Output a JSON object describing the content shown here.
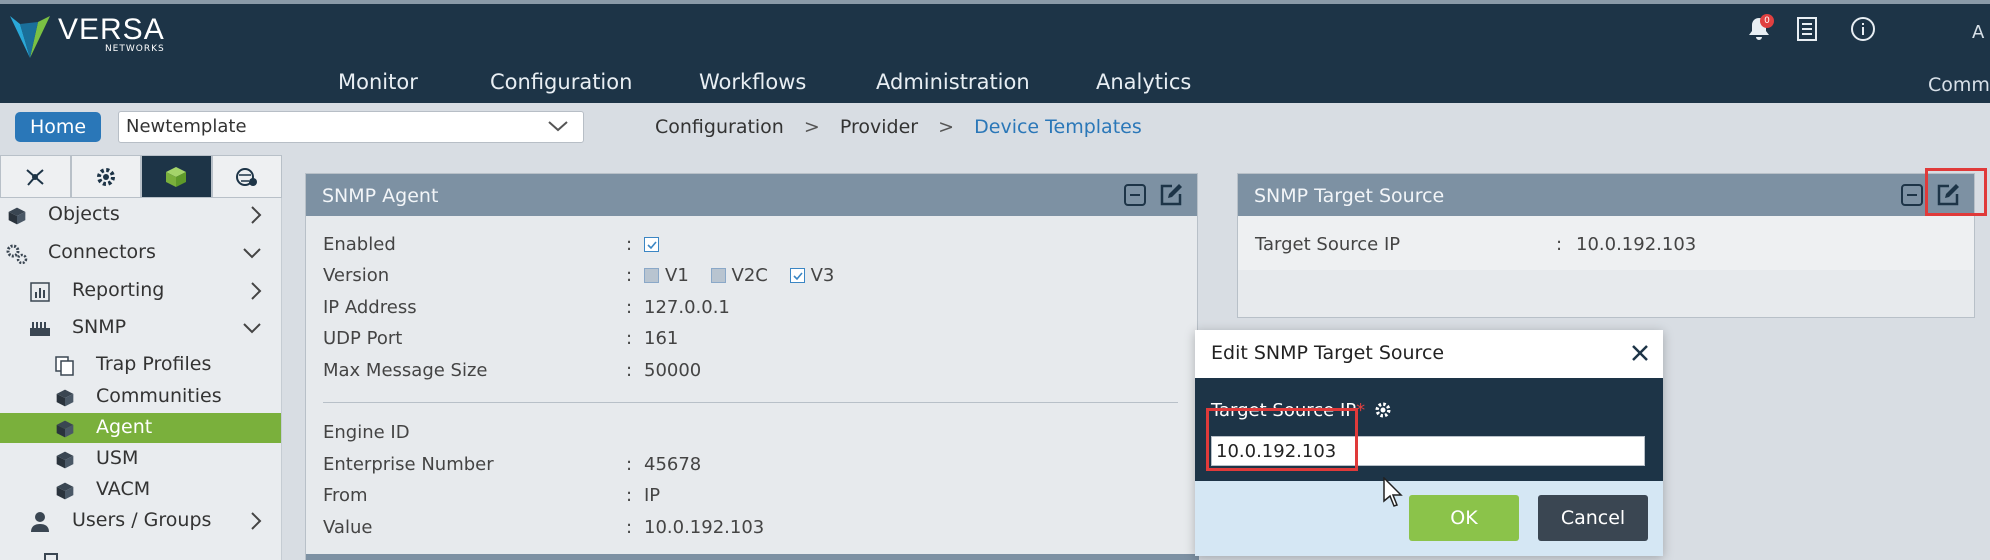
{
  "brand": {
    "name": "VERSA",
    "sub": "NETWORKS"
  },
  "header": {
    "menu": [
      "Monitor",
      "Configuration",
      "Workflows",
      "Administration",
      "Analytics"
    ],
    "notification_count": "0",
    "account_initial": "A",
    "right_menu": "Comm"
  },
  "subbar": {
    "home_label": "Home",
    "template": "Newtemplate",
    "breadcrumb": {
      "item1": "Configuration",
      "sep": ">",
      "item2": "Provider",
      "item3": "Device Templates"
    }
  },
  "sidebar": {
    "tabs": [
      "network-icon",
      "gear-icon",
      "cube-icon",
      "globe-gear-icon"
    ],
    "items": [
      {
        "label": "Objects"
      },
      {
        "label": "Connectors"
      },
      {
        "label": "Reporting"
      },
      {
        "label": "SNMP"
      },
      {
        "label": "Trap Profiles"
      },
      {
        "label": "Communities"
      },
      {
        "label": "Agent"
      },
      {
        "label": "USM"
      },
      {
        "label": "VACM"
      },
      {
        "label": "Users / Groups"
      }
    ]
  },
  "snmp_agent": {
    "title": "SNMP Agent",
    "colon": ":",
    "fields": {
      "enabled": {
        "label": "Enabled"
      },
      "version": {
        "label": "Version",
        "v1": "V1",
        "v2c": "V2C",
        "v3": "V3"
      },
      "ip": {
        "label": "IP Address",
        "value": "127.0.0.1"
      },
      "udp": {
        "label": "UDP Port",
        "value": "161"
      },
      "max": {
        "label": "Max Message Size",
        "value": "50000"
      }
    },
    "engine": {
      "heading": "Engine ID",
      "enterprise": {
        "label": "Enterprise Number",
        "value": "45678"
      },
      "from": {
        "label": "From",
        "value": "IP"
      },
      "value": {
        "label": "Value",
        "value": "10.0.192.103"
      }
    }
  },
  "snmp_target": {
    "title": "SNMP Target Source",
    "label": "Target Source IP",
    "colon": ":",
    "value": "10.0.192.103"
  },
  "dialog": {
    "title": "Edit SNMP Target Source",
    "field_label": "Target Source IP",
    "required_mark": "*",
    "field_value": "10.0.192.103",
    "ok": "OK",
    "cancel": "Cancel"
  },
  "colors": {
    "header": "#1d3447",
    "accent": "#2a77b8",
    "active": "#7ab03c",
    "highlight": "#e03a3a"
  }
}
